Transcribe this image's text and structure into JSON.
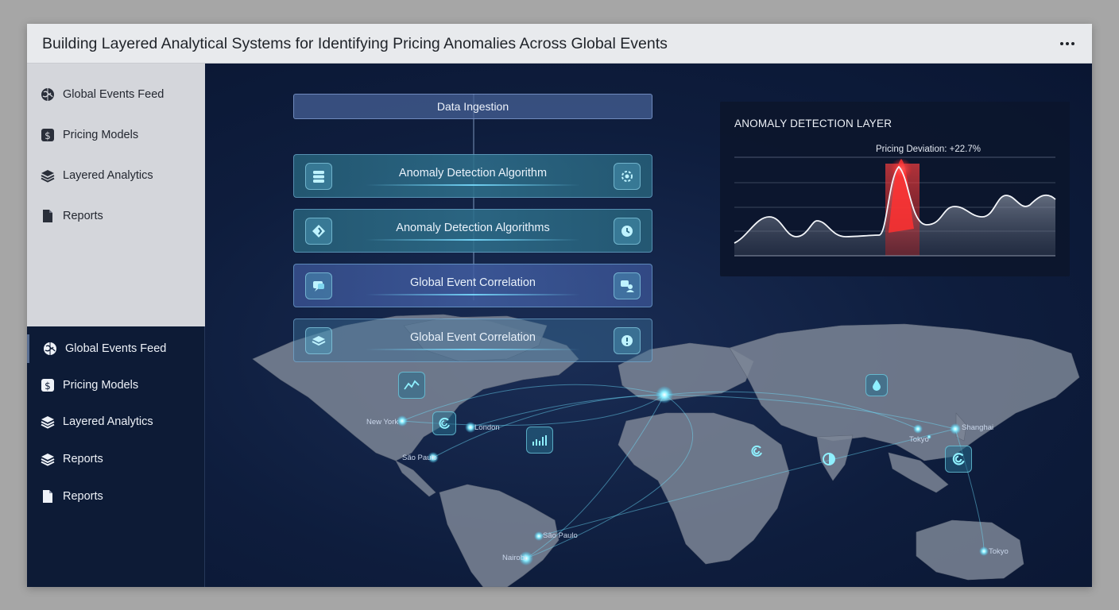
{
  "app": {
    "title": "Building Layered Analytical Systems for Identifying Pricing Anomalies Across Global Events"
  },
  "sidebar_top": {
    "items": [
      {
        "label": "Global Events Feed",
        "icon": "globe-icon"
      },
      {
        "label": "Pricing Models",
        "icon": "dollar-icon"
      },
      {
        "label": "Layered Analytics",
        "icon": "layers-icon"
      },
      {
        "label": "Reports",
        "icon": "document-icon"
      }
    ]
  },
  "sidebar_bottom": {
    "items": [
      {
        "label": "Global Events Feed",
        "icon": "globe-icon",
        "active": true
      },
      {
        "label": "Pricing Models",
        "icon": "dollar-icon"
      },
      {
        "label": "Layered Analytics",
        "icon": "layers-icon"
      },
      {
        "label": "Reports",
        "icon": "layers-icon"
      },
      {
        "label": "Reports",
        "icon": "document-icon"
      }
    ]
  },
  "pipeline": {
    "header": "Data Ingestion",
    "cards": [
      {
        "label": "Anomaly Detection Algorithm",
        "left_icon": "database-icon",
        "right_icon": "settings-icon"
      },
      {
        "label": "Anomaly Detection Algorithms",
        "left_icon": "diamond-icon",
        "right_icon": "clock-icon"
      },
      {
        "label": "Global Event Correlation",
        "left_icon": "chat-icon",
        "right_icon": "users-icon"
      },
      {
        "label": "Global Event Correlation",
        "left_icon": "stack-icon",
        "right_icon": "alert-icon"
      }
    ]
  },
  "anomaly_panel": {
    "title": "ANOMALY DETECTION LAYER",
    "deviation_label": "Pricing Deviation: +22.7%"
  },
  "map": {
    "cities": [
      "New York",
      "London",
      "São Paulo",
      "São Paulo",
      "Nairobi",
      "Tokyo",
      "Shanghai",
      "Tokyo"
    ],
    "icons": [
      "trend-chart-icon",
      "refresh-icon",
      "bar-chart-icon",
      "water-drop-icon",
      "spiral-icon",
      "half-circle-icon",
      "spiral-icon"
    ]
  },
  "colors": {
    "accent_cyan": "#6fe3ff",
    "anomaly_red": "#e03a3a",
    "panel_bg": "#0d1b36"
  }
}
